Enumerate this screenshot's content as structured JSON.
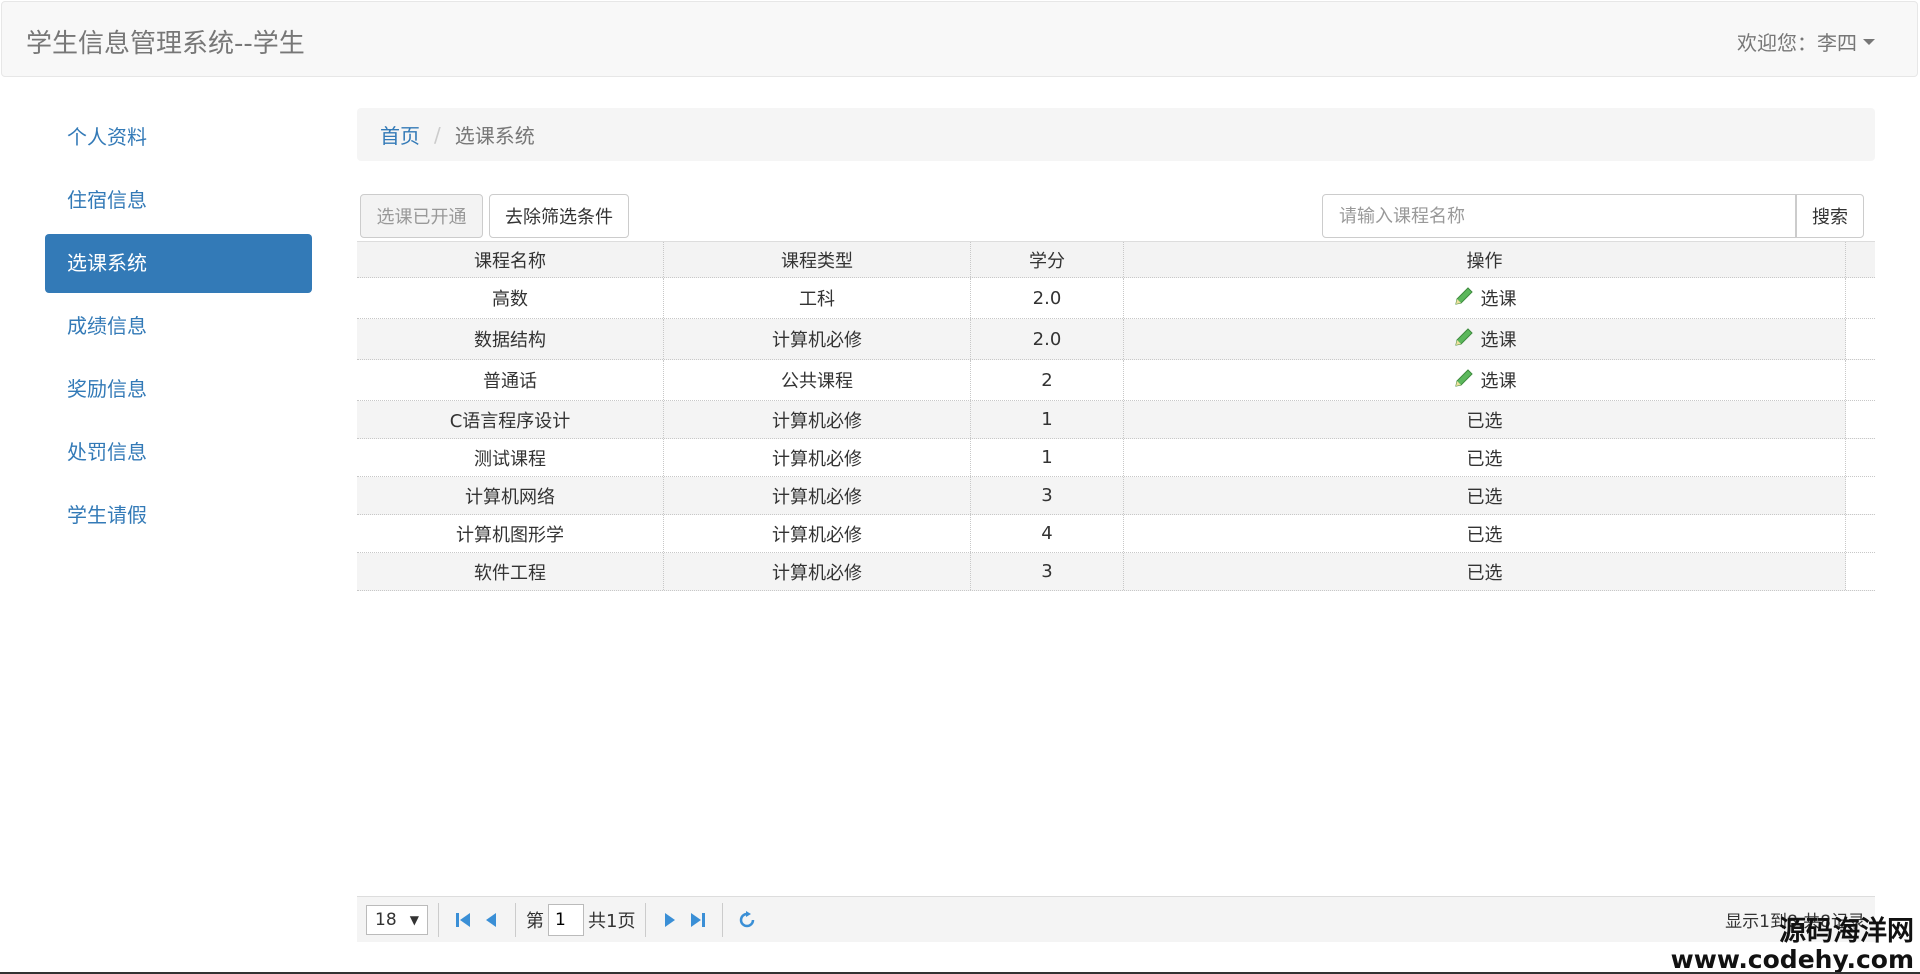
{
  "navbar": {
    "title": "学生信息管理系统--学生",
    "welcome": "欢迎您：李四"
  },
  "sidebar": {
    "items": [
      {
        "label": "个人资料"
      },
      {
        "label": "住宿信息"
      },
      {
        "label": "选课系统",
        "active": true
      },
      {
        "label": "成绩信息"
      },
      {
        "label": "奖励信息"
      },
      {
        "label": "处罚信息"
      },
      {
        "label": "学生请假"
      }
    ]
  },
  "breadcrumb": {
    "home": "首页",
    "separator": "/",
    "current": "选课系统"
  },
  "toolbar": {
    "course_open_label": "选课已开通",
    "clear_filter_label": "去除筛选条件",
    "search_placeholder": "请输入课程名称",
    "search_label": "搜索"
  },
  "table": {
    "headers": [
      "课程名称",
      "课程类型",
      "学分",
      "操作"
    ],
    "rows": [
      {
        "name": "高数",
        "type": "工科",
        "credit": "2.0",
        "action": "选课",
        "selectable": true
      },
      {
        "name": "数据结构",
        "type": "计算机必修",
        "credit": "2.0",
        "action": "选课",
        "selectable": true
      },
      {
        "name": "普通话",
        "type": "公共课程",
        "credit": "2",
        "action": "选课",
        "selectable": true
      },
      {
        "name": "C语言程序设计",
        "type": "计算机必修",
        "credit": "1",
        "action": "已选",
        "selectable": false
      },
      {
        "name": "测试课程",
        "type": "计算机必修",
        "credit": "1",
        "action": "已选",
        "selectable": false
      },
      {
        "name": "计算机网络",
        "type": "计算机必修",
        "credit": "3",
        "action": "已选",
        "selectable": false
      },
      {
        "name": "计算机图形学",
        "type": "计算机必修",
        "credit": "4",
        "action": "已选",
        "selectable": false
      },
      {
        "name": "软件工程",
        "type": "计算机必修",
        "credit": "3",
        "action": "已选",
        "selectable": false
      }
    ]
  },
  "pager": {
    "page_size": "18",
    "page_prefix": "第",
    "page_value": "1",
    "page_total": "共1页",
    "info": "显示1到8,共8记录"
  },
  "watermark": {
    "cn": "源码海洋网",
    "url": "www.codehy.com"
  },
  "icons": {
    "pencil": "pencil-icon",
    "first": "first-page-icon",
    "prev": "prev-page-icon",
    "next": "next-page-icon",
    "last": "last-page-icon",
    "refresh": "refresh-icon"
  },
  "colors": {
    "primary": "#337ab7",
    "pencil": "#5cb85c",
    "pager_icon": "#3a8fd6"
  }
}
